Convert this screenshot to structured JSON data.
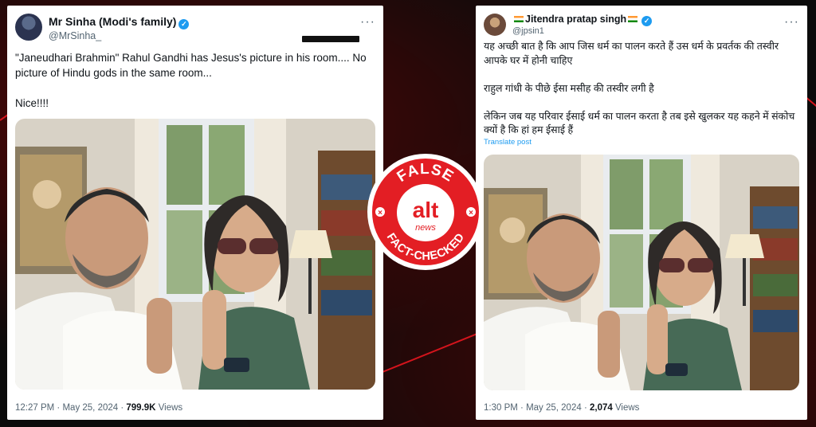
{
  "left_tweet": {
    "display_name": "Mr Sinha (Modi's family)",
    "handle": "@MrSinha_",
    "text": "\"Janeudhari Brahmin\" Rahul Gandhi has Jesus's picture in his room.... No picture of Hindu gods in the same room...\n\n Nice!!!!",
    "time": "12:27 PM",
    "date": "May 25, 2024",
    "views_count": "799.9K",
    "views_label": "Views"
  },
  "right_tweet": {
    "display_name": "Jitendra pratap singh",
    "handle": "@jpsin1",
    "text": "यह अच्छी बात है कि आप जिस धर्म का पालन करते हैं उस धर्म के प्रवर्तक की तस्वीर आपके घर में होनी चाहिए\n\nराहुल गांधी के पीछे ईसा मसीह की तस्वीर लगी है\n\nलेकिन जब यह परिवार ईसाई धर्म का पालन करता है तब इसे खुलकर यह कहने में संकोच क्यों है कि हां हम ईसाई  हैं",
    "translate_label": "Translate post",
    "time": "1:30 PM",
    "date": "May 25, 2024",
    "views_count": "2,074",
    "views_label": "Views"
  },
  "badge": {
    "top_text": "FALSE",
    "logo_main": "alt",
    "logo_sub": "news",
    "bottom_text": "FACT-CHECKED"
  },
  "colors": {
    "badge_red": "#e31e24",
    "twitter_blue": "#1d9bf0",
    "background": "#0b0b0b"
  },
  "icons": [
    "verified-badge-icon",
    "more-options-icon",
    "india-flag-icon"
  ]
}
